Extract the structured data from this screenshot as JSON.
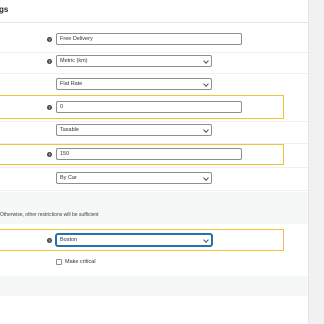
{
  "header": {
    "title": "gs"
  },
  "fields": {
    "free_delivery": "Free Delivery",
    "units": "Metric (km)",
    "rate_type": "Flat Rate",
    "value_zero": "0",
    "tax_status": "Taxable",
    "value_150": "150",
    "transport": "By Car",
    "city": "Boston"
  },
  "note": "Otherwise, other restrictions will be sufficient",
  "checkbox": {
    "label": "Make critical",
    "checked": false
  },
  "colors": {
    "highlight": "#f0c33c",
    "focus": "#2271b1"
  }
}
